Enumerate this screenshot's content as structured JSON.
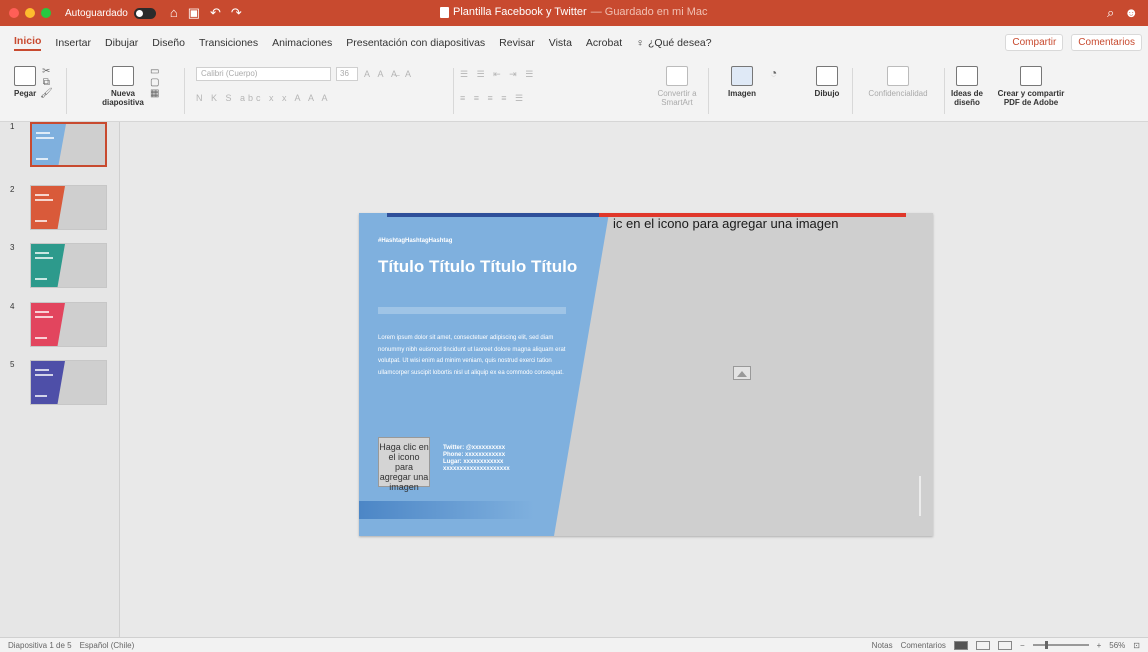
{
  "window": {
    "autosave_label": "Autoguardado",
    "autosave_state": "off",
    "doc_title": "Plantilla Facebook y Twitter",
    "doc_subtitle": "— Guardado en mi Mac",
    "traffic": [
      "#ff5f57",
      "#febc2e",
      "#28c840"
    ]
  },
  "tabs": [
    "Inicio",
    "Insertar",
    "Dibujar",
    "Diseño",
    "Transiciones",
    "Animaciones",
    "Presentación con diapositivas",
    "Revisar",
    "Vista",
    "Acrobat"
  ],
  "active_tab": "Inicio",
  "help_label": "¿Qué desea?",
  "tab_actions": {
    "share": "Compartir",
    "comments": "Comentarios"
  },
  "ribbon": {
    "paste": "Pegar",
    "new_slide": "Nueva diapositiva",
    "font_name": "Calibri (Cuerpo)",
    "font_size": "36",
    "convert": "Convertir a SmartArt",
    "image": "Imagen",
    "draw": "Dibujo",
    "confidential": "Confidencialidad",
    "design_ideas": "Ideas de diseño",
    "adobe_pdf": "Crear y compartir PDF de Adobe"
  },
  "thumbnails": [
    {
      "num": "1",
      "color": "#7fb0de",
      "active": true
    },
    {
      "num": "2",
      "color": "#d95a3a",
      "active": false
    },
    {
      "num": "3",
      "color": "#2d9a8c",
      "active": false
    },
    {
      "num": "4",
      "color": "#e2455e",
      "active": false
    },
    {
      "num": "5",
      "color": "#4e4fa8",
      "active": false
    }
  ],
  "slide": {
    "hashtag": "#HashtagHashtagHashtag",
    "title": "Título Título Título Título",
    "body": "Lorem ipsum dolor sit amet, consectetuer adipiscing elit, sed diam nonummy nibh euismod tincidunt ut laoreet dolore magna aliquam erat volutpat. Ut wisi enim ad minim veniam, quis nostrud exerci tation ullamcorper suscipit lobortis nisl ut aliquip ex ea commodo consequat.",
    "image_placeholder": "Haga clic en el icono para agregar una imagen",
    "contact": [
      "Twitter: @xxxxxxxxxx",
      "Phone: xxxxxxxxxxxx",
      "Lugar: xxxxxxxxxxxx",
      "xxxxxxxxxxxxxxxxxxxx"
    ],
    "right_placeholder": "ic en el icono para agregar una imagen"
  },
  "status": {
    "slide_count": "Diapositiva 1 de 5",
    "language": "Español (Chile)",
    "notes": "Notas",
    "comments": "Comentarios",
    "zoom": "56%"
  }
}
